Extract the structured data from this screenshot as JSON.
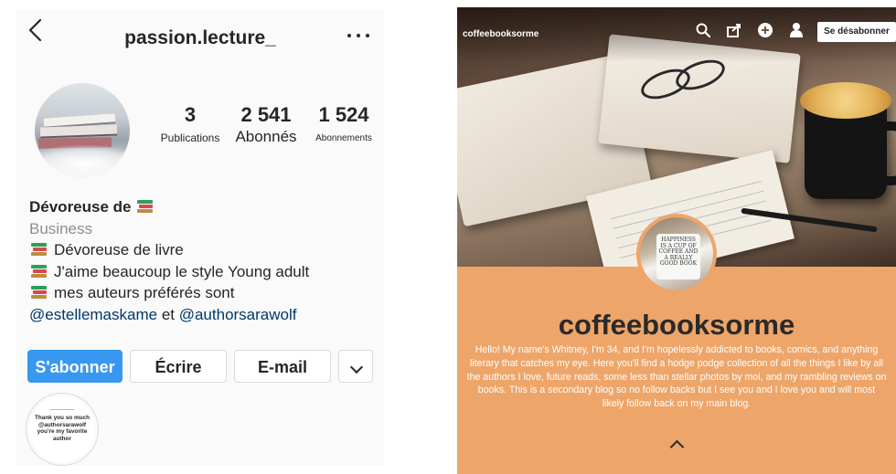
{
  "instagram": {
    "username": "passion.lecture_",
    "stats": [
      {
        "value": "3",
        "label": "Publications"
      },
      {
        "value": "2 541",
        "label": "Abonnés"
      },
      {
        "value": "1 524",
        "label": "Abonnements"
      }
    ],
    "bio": {
      "name": "Dévoreuse de",
      "category": "Business",
      "lines": [
        "Dévoreuse de livre",
        "J'aime beaucoup le style Young adult",
        "mes auteurs préférés sont"
      ],
      "mention_1": "@estellemaskame",
      "mention_join": " et ",
      "mention_2": "@authorsarawolf"
    },
    "buttons": {
      "follow": "S'abonner",
      "message": "Écrire",
      "email": "E-mail"
    },
    "highlight_text": "Thank you so much\n@authorsarawolf\nyou're my favorite\nauthor",
    "icons": [
      "back-arrow-icon",
      "more-dots-icon",
      "books-emoji-icon",
      "chevron-down-icon"
    ],
    "colors": {
      "follow_button": "#3897f0",
      "mention": "#00376b",
      "category": "#8e8e8e"
    }
  },
  "tumblr": {
    "header_username": "coffeebooksorme",
    "unfollow_label": "Se désabonner",
    "blog_title": "coffeebooksorme",
    "avatar_mug_text": "HAPPINESS IS A CUP OF COFFEE AND A REALLY GOOD BOOK",
    "description": "Hello! My name's Whitney, I'm 34, and I'm hopelessly addicted to books, comics, and anything literary that catches my eye. Here you'll find a hodge podge collection of all the things I like by all the authors I love, future reads, some less than stellar photos by moi, and my rambling reviews on books. This is a secondary blog so no follow backs but I see you and I love you and will most likely follow back on my main blog.",
    "icons": [
      "search-icon",
      "share-icon",
      "add-icon",
      "user-icon",
      "caret-up-icon"
    ],
    "colors": {
      "background": "#eda56a",
      "title": "#2a2a2a",
      "description": "#ffffff"
    }
  }
}
